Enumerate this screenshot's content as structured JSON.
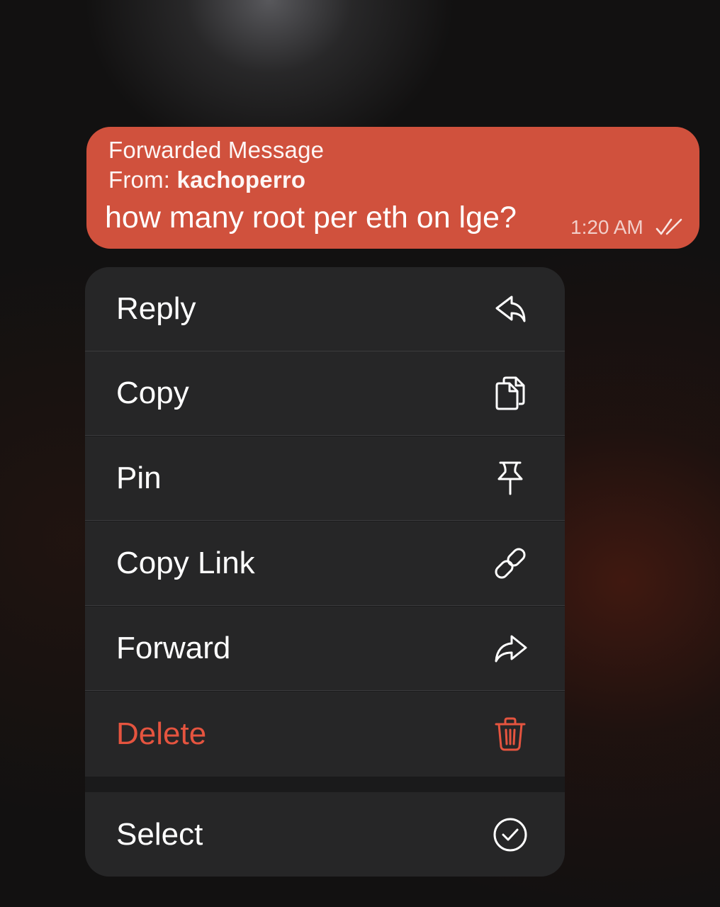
{
  "message": {
    "forwarded_label": "Forwarded Message",
    "from_prefix": "From: ",
    "from_sender": "kachoperro",
    "text": "how many root per eth on lge?",
    "time": "1:20 AM",
    "status_icon": "double-check-icon",
    "bubble_color": "#d0513d"
  },
  "menu": {
    "items": [
      {
        "label": "Reply",
        "icon": "reply-icon"
      },
      {
        "label": "Copy",
        "icon": "copy-icon"
      },
      {
        "label": "Pin",
        "icon": "pin-icon"
      },
      {
        "label": "Copy Link",
        "icon": "link-icon"
      },
      {
        "label": "Forward",
        "icon": "forward-icon"
      },
      {
        "label": "Delete",
        "icon": "trash-icon",
        "color": "#e5543f"
      },
      {
        "label": "Select",
        "icon": "check-circle-icon"
      }
    ]
  }
}
